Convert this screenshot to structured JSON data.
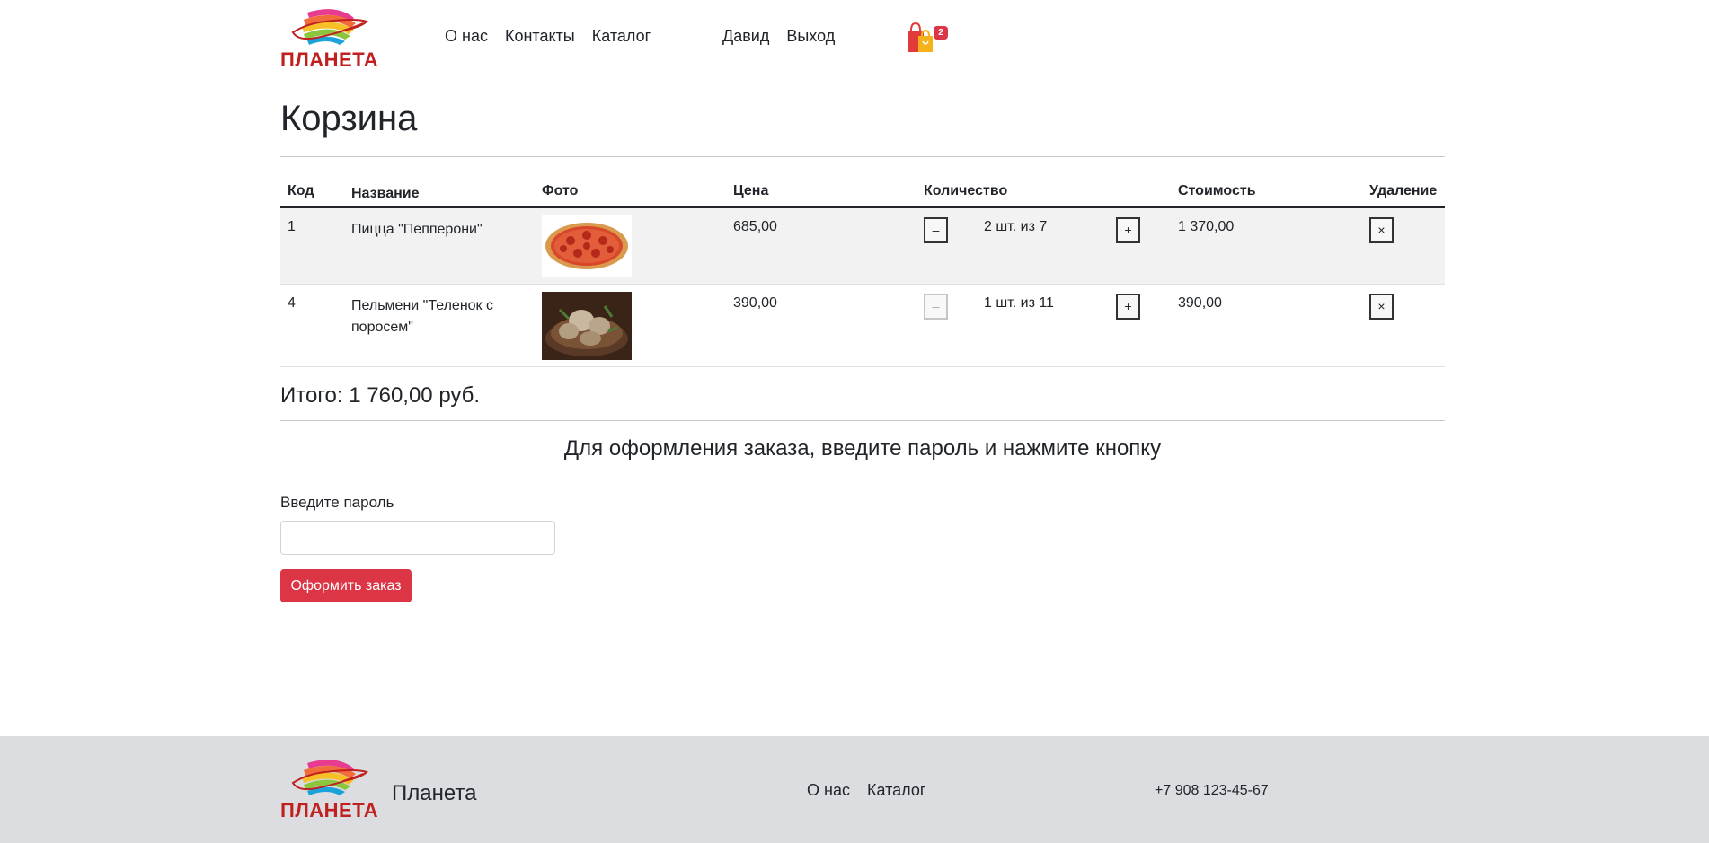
{
  "header": {
    "logo_text": "ПЛАНЕТА",
    "nav": [
      "О нас",
      "Контакты",
      "Каталог"
    ],
    "user_nav": [
      "Давид",
      "Выход"
    ],
    "cart_count": "2"
  },
  "page": {
    "title": "Корзина"
  },
  "table": {
    "headers": [
      "Код",
      "Название",
      "Фото",
      "Цена",
      "Количество",
      "Стоимость",
      "Удаление"
    ],
    "rows": [
      {
        "code": "1",
        "name": "Пицца \"Пепперони\"",
        "photo_icon": "pizza-photo",
        "price": "685,00",
        "minus": "–",
        "qty": "2 шт. из 7",
        "plus": "+",
        "cost": "1 370,00",
        "delete": "×"
      },
      {
        "code": "4",
        "name": "Пельмени \"Теленок с поросем\"",
        "photo_icon": "dumplings-photo",
        "price": "390,00",
        "minus": "–",
        "qty": "1 шт. из 11",
        "plus": "+",
        "cost": "390,00",
        "delete": "×"
      }
    ]
  },
  "summary": {
    "total": "Итого: 1 760,00 руб."
  },
  "order": {
    "heading": "Для оформления заказа, введите пароль и нажмите кнопку",
    "password_label": "Введите пароль",
    "password_value": "",
    "submit_label": "Оформить заказ"
  },
  "footer": {
    "logo_text": "ПЛАНЕТА",
    "brand": "Планета",
    "nav": [
      "О нас",
      "Каталог"
    ],
    "phone": "+7 908 123-45-67"
  },
  "colors": {
    "accent": "#dc3545",
    "footer_bg": "#dcdde0",
    "logo_red": "#c0201f"
  }
}
